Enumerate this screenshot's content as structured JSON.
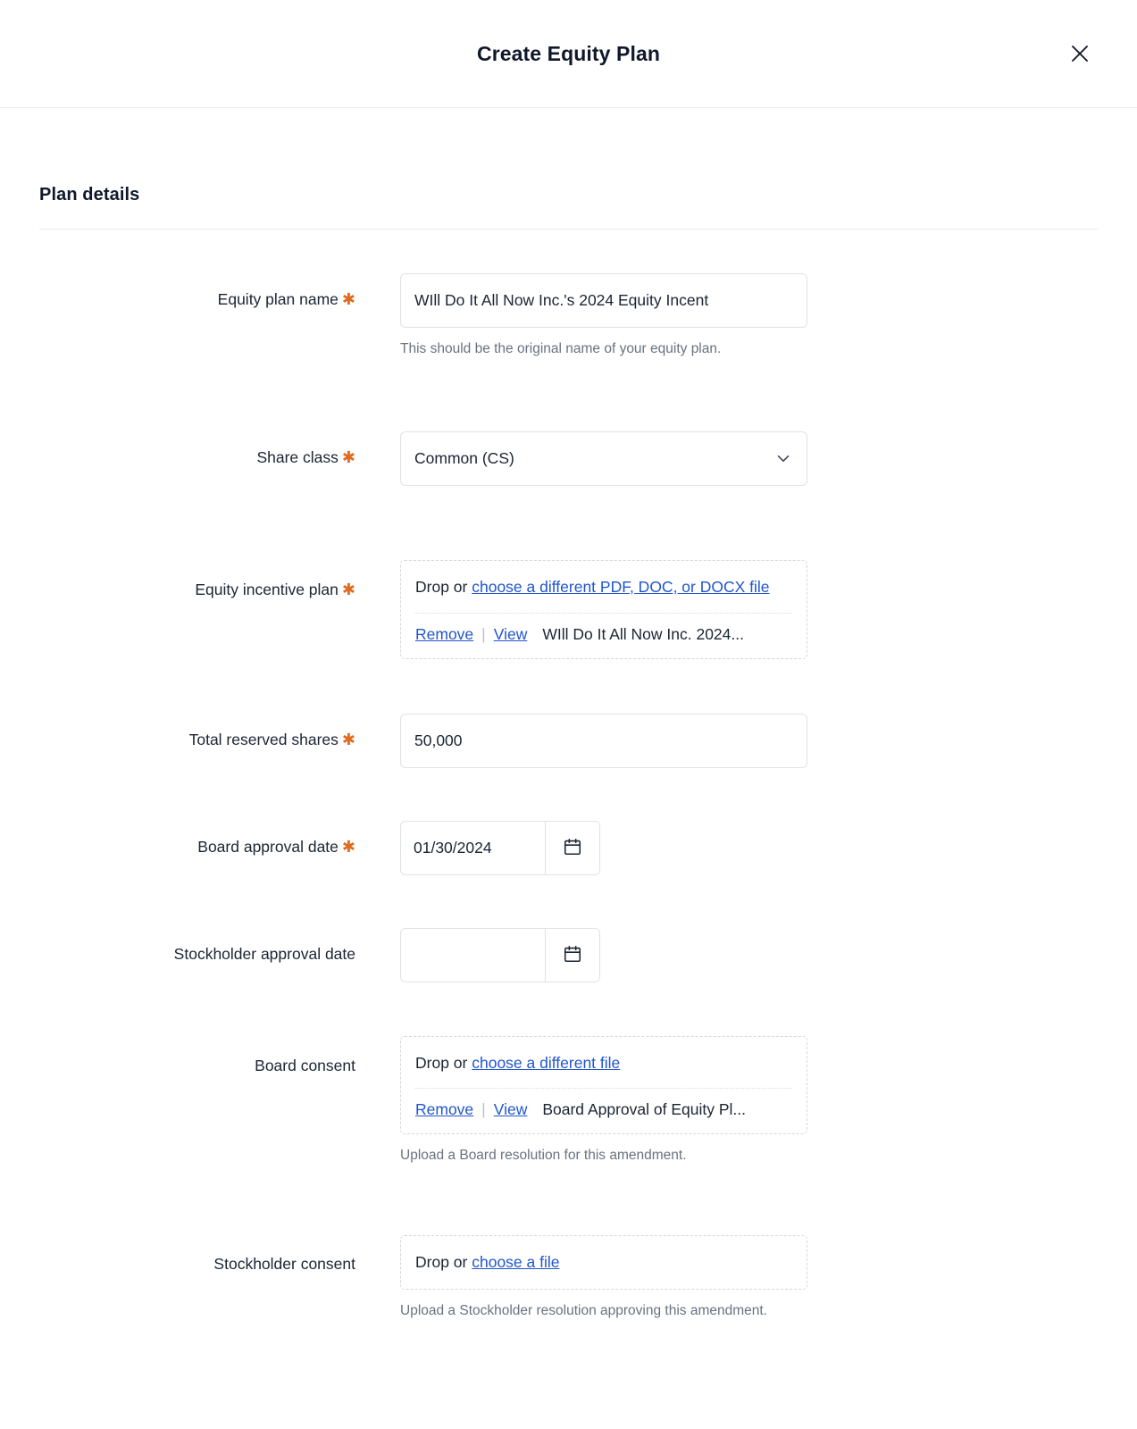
{
  "header": {
    "title": "Create Equity Plan",
    "close_label": "×"
  },
  "section": {
    "title": "Plan details"
  },
  "fields": {
    "plan_name": {
      "label": "Equity plan name",
      "required": true,
      "value": "WIll Do It All Now Inc.'s 2024 Equity Incent",
      "placeholder": "",
      "help": "This should be the original name of your equity plan."
    },
    "share_class": {
      "label": "Share class",
      "required": true,
      "value": "Common (CS)"
    },
    "equity_incentive_plan": {
      "label": "Equity incentive plan",
      "required": true,
      "drop_prefix": "Drop or",
      "drop_link": "choose a different PDF, DOC, or DOCX file",
      "remove_label": "Remove",
      "view_label": "View",
      "separator": "|",
      "file_name": "WIll Do It All Now Inc. 2024..."
    },
    "total_reserved_shares": {
      "label": "Total reserved shares",
      "required": true,
      "value": "50,000"
    },
    "board_approval_date": {
      "label": "Board approval date",
      "required": true,
      "value": "01/30/2024",
      "placeholder": ""
    },
    "stockholder_approval_date": {
      "label": "Stockholder approval date",
      "required": false,
      "value": "",
      "placeholder": ""
    },
    "board_consent": {
      "label": "Board consent",
      "required": false,
      "drop_prefix": "Drop or",
      "drop_link": "choose a different file",
      "remove_label": "Remove",
      "view_label": "View",
      "separator": "|",
      "file_name": "Board Approval of Equity Pl...",
      "help": "Upload a Board resolution for this amendment."
    },
    "stockholder_consent": {
      "label": "Stockholder consent",
      "required": false,
      "drop_prefix": "Drop or",
      "drop_link": "choose a file",
      "help": "Upload a Stockholder resolution approving this amendment."
    }
  },
  "colors": {
    "required_asterisk": "#e06a1f",
    "link": "#2155cd",
    "text": "#1c2433",
    "muted_text": "#6a7280",
    "border": "#dfe2e6"
  }
}
